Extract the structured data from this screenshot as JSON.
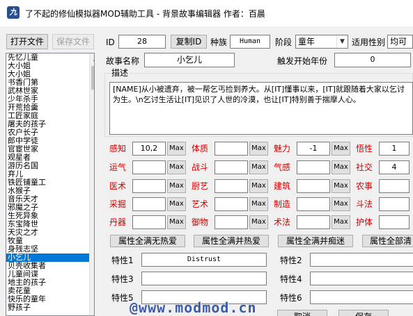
{
  "window": {
    "title": "了不起的修仙模拟器MOD辅助工具 - 背景故事编辑器      作者：百晨"
  },
  "toolbar": {
    "open_file": "打开文件",
    "save_file": "保存文件"
  },
  "story_list": {
    "items": [
      "先忆儿童",
      "大小姐",
      "大小姐",
      "书香门第",
      "武林世家",
      "少年杀手",
      "开荒拾羹",
      "工匠家庭",
      "屠夫的孩子",
      "农户长子",
      "郎中学徒",
      "官宦世家",
      "观星者",
      "游历名国",
      "弃儿",
      "铁匠铺童工",
      "水猴子",
      "音乐天才",
      "邪魔之子",
      "生死异象",
      "东宝降世",
      "天灾之才",
      "牧童",
      "身残志坚",
      "小乞儿",
      "贝壳收集者",
      "儿童间谍",
      "地主的孩子",
      "卖花童",
      "快乐的童年",
      "野孩子"
    ],
    "selected_index": 24
  },
  "form": {
    "id_label": "ID",
    "id_value": "28",
    "copy_id": "复制ID",
    "race_label": "种族",
    "race_value": "Human",
    "stage_label": "阶段",
    "stage_value": "童年",
    "gender_label": "适用性别",
    "gender_value": "均可",
    "story_name_label": "故事名称",
    "story_name_value": "小乞儿",
    "trigger_age_label": "触发开始年份",
    "trigger_age_value": "0",
    "desc_label": "描述",
    "desc_text": "[NAME]从小被遗弃，被一帮乞丐捡到养大。从[IT]懂事以来，[IT]就跟随着大家以乞讨为生。\\n乞讨生活让[IT]见识了人世的冷漠，也让[IT]特别善于揣摩人心。"
  },
  "max_label": "Max",
  "attributes": [
    {
      "label": "感知",
      "value": "10,2",
      "color": "red"
    },
    {
      "label": "体质",
      "value": "",
      "color": "red"
    },
    {
      "label": "魅力",
      "value": "-1",
      "color": "red"
    },
    {
      "label": "悟性",
      "value": "1",
      "color": "red"
    },
    {
      "label": "运气",
      "value": "",
      "color": "red"
    },
    {
      "label": "战斗",
      "value": "",
      "color": "red"
    },
    {
      "label": "气感",
      "value": "",
      "color": "red"
    },
    {
      "label": "社交",
      "value": "4",
      "color": "red"
    },
    {
      "label": "医术",
      "value": "",
      "color": "red"
    },
    {
      "label": "厨艺",
      "value": "",
      "color": "red"
    },
    {
      "label": "建筑",
      "value": "",
      "color": "red"
    },
    {
      "label": "农事",
      "value": "",
      "color": "red"
    },
    {
      "label": "采掘",
      "value": "",
      "color": "red"
    },
    {
      "label": "艺术",
      "value": "",
      "color": "red"
    },
    {
      "label": "制造",
      "value": "",
      "color": "red"
    },
    {
      "label": "斗法",
      "value": "",
      "color": "red"
    },
    {
      "label": "丹器",
      "value": "",
      "color": "red"
    },
    {
      "label": "御物",
      "value": "",
      "color": "red"
    },
    {
      "label": "术法",
      "value": "",
      "color": "red"
    },
    {
      "label": "护体",
      "value": "",
      "color": "red"
    }
  ],
  "presets": [
    "属性全满无热爱",
    "属性全满并热爱",
    "属性全满并痴迷",
    "属性全部清"
  ],
  "traits": [
    {
      "label": "特性1",
      "value": "Distrust"
    },
    {
      "label": "特性2",
      "value": ""
    },
    {
      "label": "特性3",
      "value": ""
    },
    {
      "label": "特性4",
      "value": ""
    },
    {
      "label": "特性5",
      "value": ""
    },
    {
      "label": "特性6",
      "value": ""
    }
  ],
  "dialog": {
    "cancel": "取消",
    "confirm": "保存"
  },
  "watermark": "@www.modmod.cn",
  "colors": {
    "selection": "#0078d7",
    "attr_label": "#d00000",
    "watermark": "#3b5bb0"
  }
}
